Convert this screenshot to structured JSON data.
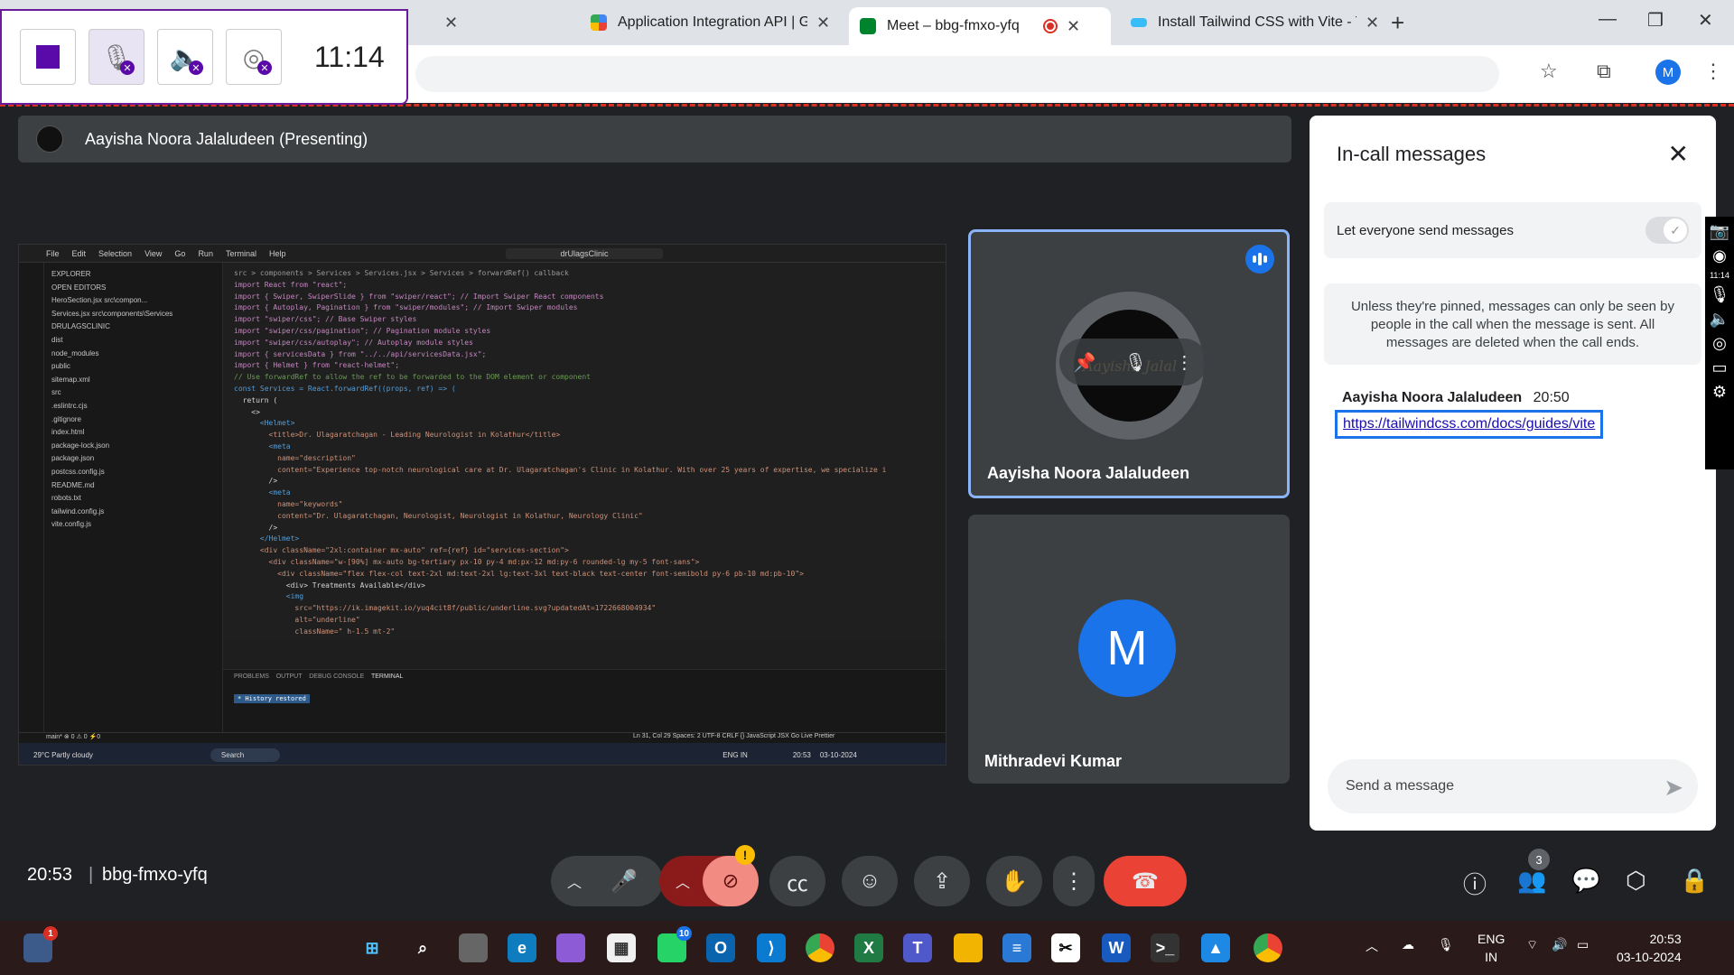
{
  "browser": {
    "tabs": [
      {
        "label": "",
        "active": false
      },
      {
        "label": "Application Integration API  |  G",
        "active": false
      },
      {
        "label": "Meet – bbg-fmxo-yfq",
        "active": true
      },
      {
        "label": "Install Tailwind CSS with Vite - T",
        "active": false
      }
    ],
    "new_tab": "+",
    "profile_initial": "M"
  },
  "recorder": {
    "time": "11:14"
  },
  "presenting": {
    "label": "Aayisha Noora Jalaludeen (Presenting)"
  },
  "screen_share": {
    "menu": [
      "File",
      "Edit",
      "Selection",
      "View",
      "Go",
      "Run",
      "Terminal",
      "Help"
    ],
    "search": "drUlagsClinic",
    "explorer_items": [
      "EXPLORER",
      "OPEN EDITORS",
      "HeroSection.jsx src\\compon...",
      "Services.jsx src\\components\\Services",
      "DRULAGSCLINIC",
      "dist",
      "node_modules",
      "public",
      "sitemap.xml",
      "src",
      ".eslintrc.cjs",
      ".gitignore",
      "index.html",
      "package-lock.json",
      "package.json",
      "postcss.config.js",
      "README.md",
      "robots.txt",
      "tailwind.config.js",
      "vite.config.js"
    ],
    "tabs": [
      "HeroSection.jsx M",
      "Services.jsx"
    ],
    "breadcrumb": "src > components > Services > Services.jsx > Services > forwardRef() callback",
    "code_lines": [
      {
        "t": "kw",
        "s": "import React from \"react\";"
      },
      {
        "t": "kw",
        "s": "import { Swiper, SwiperSlide } from \"swiper/react\"; // Import Swiper React components"
      },
      {
        "t": "kw",
        "s": "import { Autoplay, Pagination } from \"swiper/modules\"; // Import Swiper modules"
      },
      {
        "t": "kw",
        "s": "import \"swiper/css\"; // Base Swiper styles"
      },
      {
        "t": "kw",
        "s": "import \"swiper/css/pagination\"; // Pagination module styles"
      },
      {
        "t": "kw",
        "s": "import \"swiper/css/autoplay\"; // Autoplay module styles"
      },
      {
        "t": "kw",
        "s": "import { servicesData } from \"../../api/servicesData.jsx\";"
      },
      {
        "t": "kw",
        "s": "import { Helmet } from \"react-helmet\";"
      },
      {
        "t": "",
        "s": ""
      },
      {
        "t": "cm",
        "s": "// Use forwardRef to allow the ref to be forwarded to the DOM element or component"
      },
      {
        "t": "tg",
        "s": "const Services = React.forwardRef((props, ref) => ("
      },
      {
        "t": "",
        "s": "  return ("
      },
      {
        "t": "",
        "s": "    <>"
      },
      {
        "t": "tg",
        "s": "      <Helmet>"
      },
      {
        "t": "st",
        "s": "        <title>Dr. Ulagaratchagan - Leading Neurologist in Kolathur</title>"
      },
      {
        "t": "tg",
        "s": "        <meta"
      },
      {
        "t": "st",
        "s": "          name=\"description\""
      },
      {
        "t": "st",
        "s": "          content=\"Experience top-notch neurological care at Dr. Ulagaratchagan's Clinic in Kolathur. With over 25 years of expertise, we specialize i"
      },
      {
        "t": "",
        "s": "        />"
      },
      {
        "t": "tg",
        "s": "        <meta"
      },
      {
        "t": "st",
        "s": "          name=\"keywords\""
      },
      {
        "t": "st",
        "s": "          content=\"Dr. Ulagaratchagan, Neurologist, Neurologist in Kolathur, Neurology Clinic\""
      },
      {
        "t": "",
        "s": "        />"
      },
      {
        "t": "tg",
        "s": "      </Helmet>"
      },
      {
        "t": "st",
        "s": "      <div className=\"2xl:container mx-auto\" ref={ref} id=\"services-section\">"
      },
      {
        "t": "st",
        "s": "        <div className=\"w-[90%] mx-auto bg-tertiary px-10 py-4 md:px-12 md:py-6 rounded-lg my-5 font-sans\">"
      },
      {
        "t": "st",
        "s": "          <div className=\"flex flex-col text-2xl md:text-2xl lg:text-3xl text-black text-center font-semibold py-6 pb-10 md:pb-10\">"
      },
      {
        "t": "",
        "s": "            <div> Treatments Available</div>"
      },
      {
        "t": "tg",
        "s": "            <img"
      },
      {
        "t": "st",
        "s": "              src=\"https://ik.imagekit.io/yuq4cit8f/public/underline.svg?updatedAt=1722668004934\""
      },
      {
        "t": "st",
        "s": "              alt=\"underline\""
      },
      {
        "t": "st",
        "s": "              className=\" h-1.5 mt-2\""
      }
    ],
    "panel_tabs": [
      "PROBLEMS",
      "OUTPUT",
      "DEBUG CONSOLE",
      "TERMINAL"
    ],
    "terminal_text": "* History restored",
    "status_left": "main*  ⊗ 0 ⚠ 0   ⚡0",
    "status_right": "Ln 31, Col 29   Spaces: 2   UTF-8   CRLF   {} JavaScript JSX   Go Live   Prettier",
    "weather": "29°C Partly cloudy",
    "taskbar_search": "Search",
    "taskbar_lang": "ENG IN",
    "taskbar_time": "20:53",
    "taskbar_date": "03-10-2024"
  },
  "participants": [
    {
      "name": "Aayisha Noora Jalaludeen",
      "logo_text": "Aayisha Jalal"
    },
    {
      "name": "Mithradevi Kumar",
      "initial": "M"
    }
  ],
  "chat": {
    "title": "In-call messages",
    "toggle_label": "Let everyone send messages",
    "info": "Unless they're pinned, messages can only be seen by people in the call when the message is sent. All messages are deleted when the call ends.",
    "messages": [
      {
        "sender": "Aayisha Noora Jalaludeen",
        "time": "20:50",
        "text": "https://tailwindcss.com/docs/guides/vite"
      }
    ],
    "input_placeholder": "Send a message"
  },
  "side_strip_time": "11:14",
  "meeting": {
    "time": "20:53",
    "separator": "|",
    "code": "bbg-fmxo-yfq",
    "people_count": "3"
  },
  "taskbar": {
    "notification_badge": "1",
    "whatsapp_badge": "10",
    "lang_line1": "ENG",
    "lang_line2": "IN",
    "time": "20:53",
    "date": "03-10-2024"
  },
  "colors": {
    "meet_bg": "#202124",
    "accent_blue": "#1a73e8",
    "end_call_red": "#ea4335",
    "recorder_purple": "#5a0aa8"
  }
}
